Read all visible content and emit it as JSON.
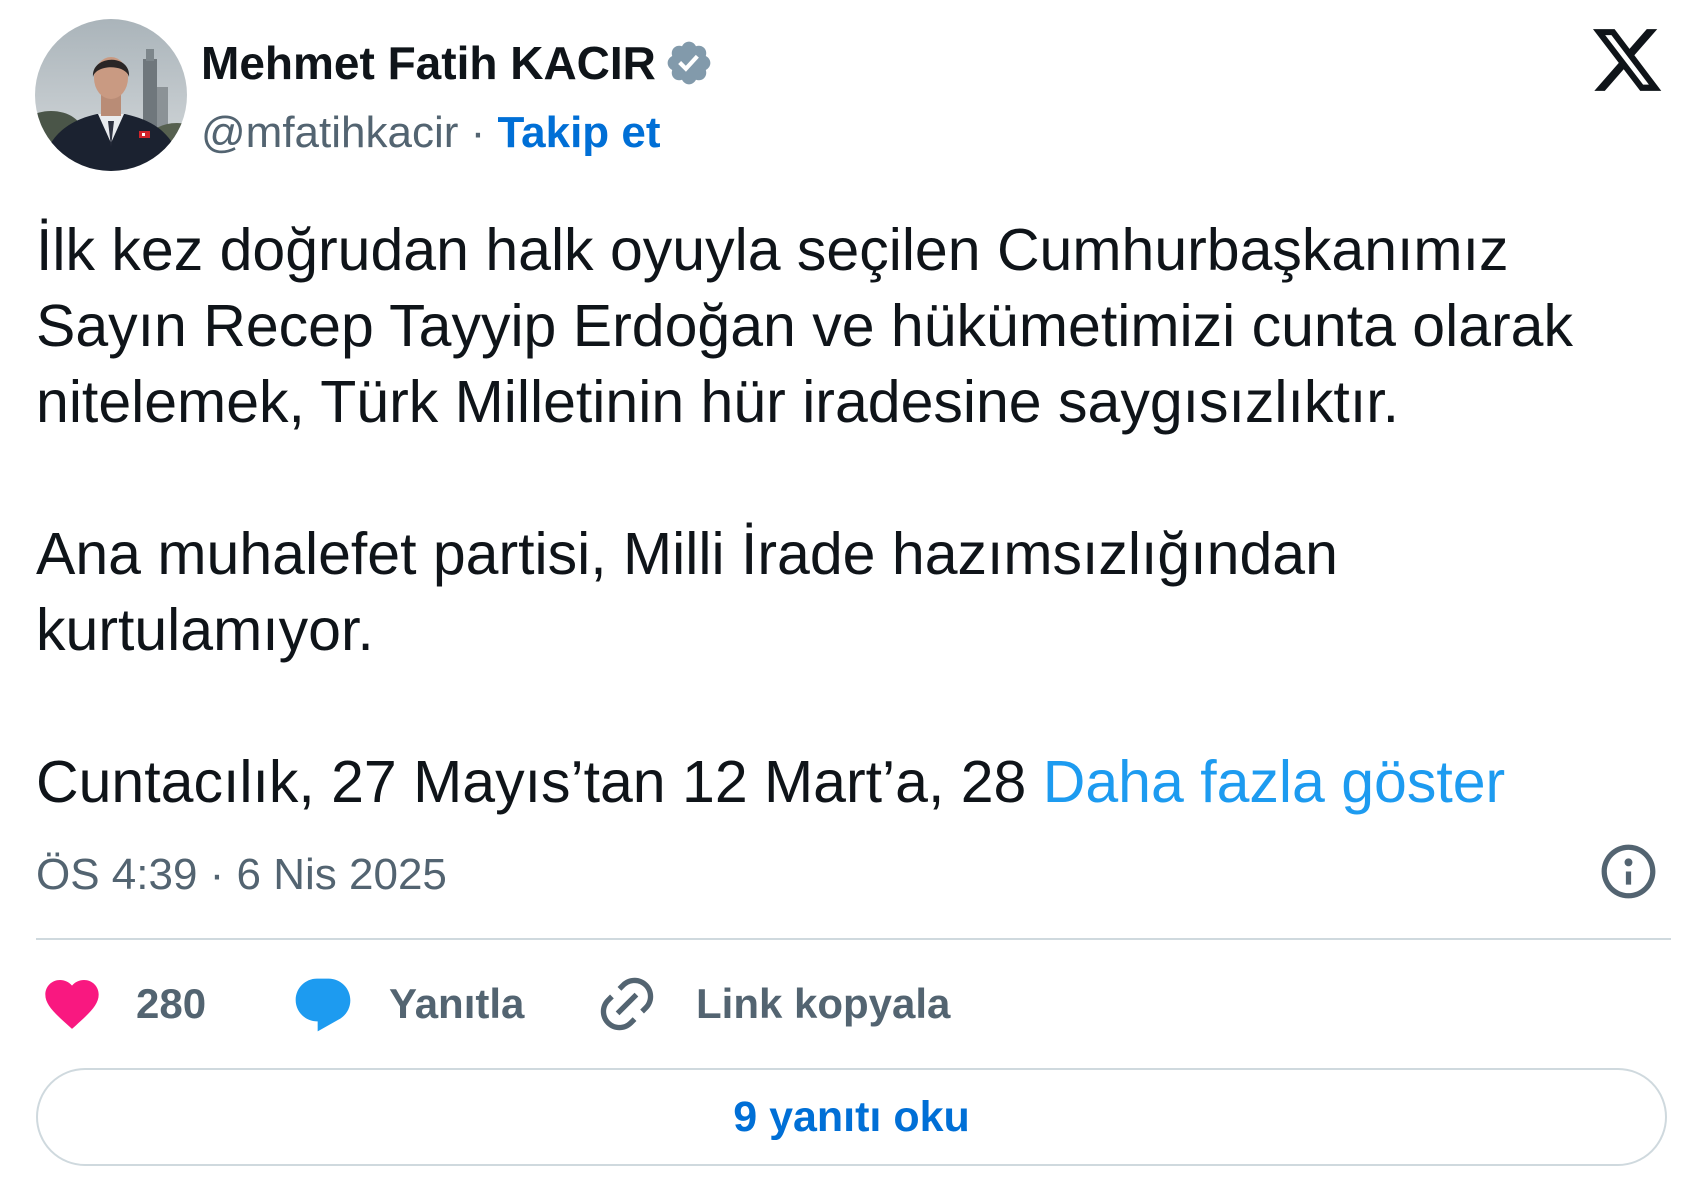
{
  "author": {
    "name": "Mehmet Fatih KACIR",
    "handle": "@mfatihkacir",
    "separator": "·",
    "follow_label": "Takip et",
    "verified": true
  },
  "tweet": {
    "paragraphs": [
      "İlk kez doğrudan halk oyuyla seçilen Cumhurbaşkanımız\nSayın Recep Tayyip Erdoğan ve hükümetimizi cunta olarak\nnitelemek, Türk Milletinin hür iradesine saygısızlıktır.",
      "Ana muhalefet partisi, Milli İrade hazımsızlığından\nkurtulamıyor."
    ],
    "truncated_text": "Cuntacılık, 27 Mayıs’tan 12 Mart’a, 28",
    "show_more_label": "Daha fazla göster",
    "timestamp": "ÖS 4:39 · 6 Nis 2025"
  },
  "actions": {
    "likes": "280",
    "reply_label": "Yanıtla",
    "copy_link_label": "Link kopyala"
  },
  "read_replies_label": "9 yanıtı oku",
  "icons": {
    "platform_logo": "x-logo",
    "verified": "verified-badge",
    "info": "info-circle",
    "like": "heart",
    "reply": "speech-bubble",
    "copy_link": "chain-link"
  },
  "colors": {
    "text": "#0f1419",
    "secondary": "#536471",
    "link": "#1d9bf0",
    "follow": "#006fd6",
    "like": "#f91880",
    "reply": "#1d9bf0",
    "verified": "#829aab",
    "border": "#cfd9de"
  }
}
